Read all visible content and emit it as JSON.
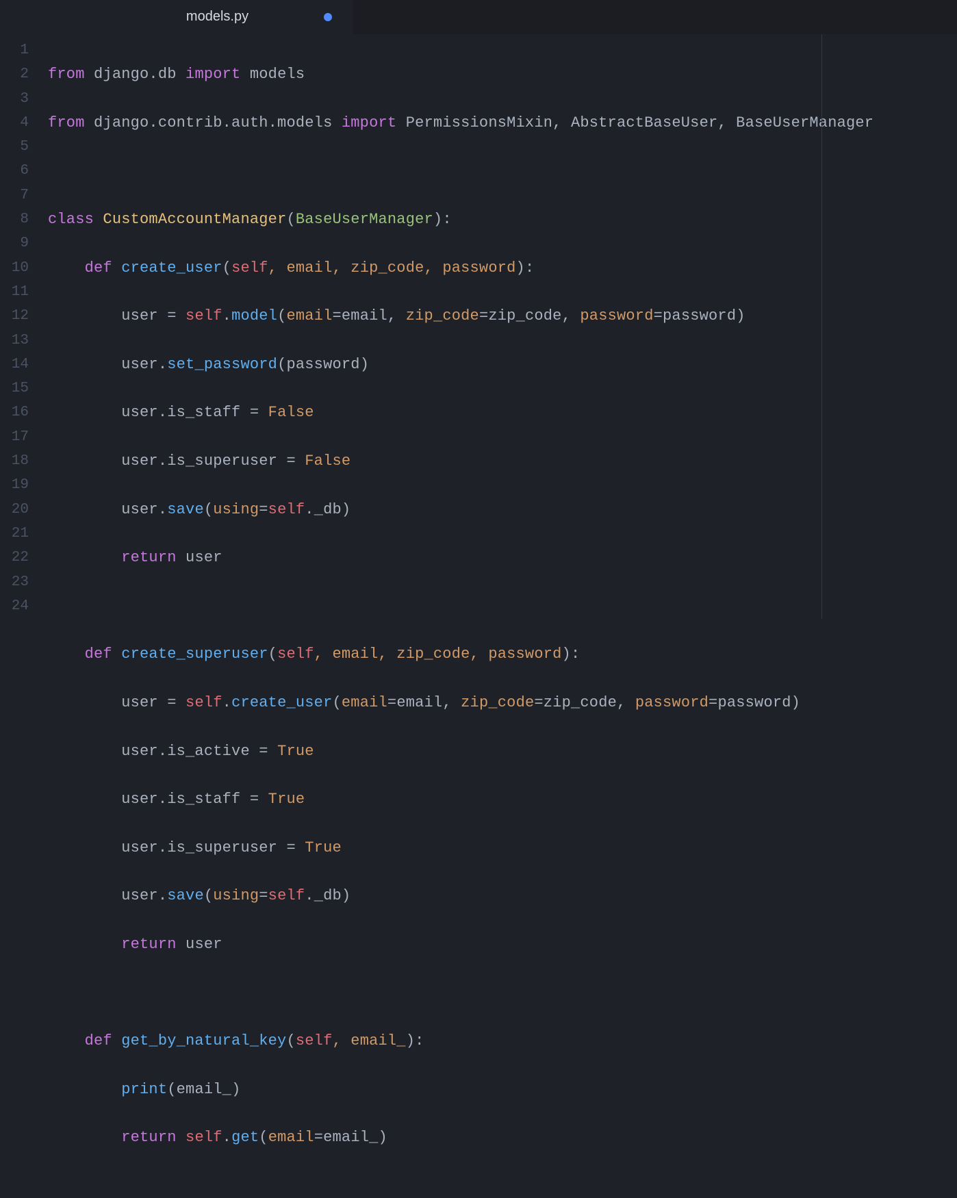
{
  "tab": {
    "label": "models.py",
    "dirty": true
  },
  "lines": [
    "1",
    "2",
    "3",
    "4",
    "5",
    "6",
    "7",
    "8",
    "9",
    "10",
    "11",
    "12",
    "13",
    "14",
    "15",
    "16",
    "17",
    "18",
    "19",
    "20",
    "21",
    "22",
    "23",
    "24"
  ],
  "code": {
    "l1": {
      "from": "from",
      "mod": " django.db ",
      "import": "import",
      "rest": " models"
    },
    "l2": {
      "from": "from",
      "mod": " django.contrib.auth.models ",
      "import": "import",
      "rest": " PermissionsMixin, AbstractBaseUser, BaseUserManager"
    },
    "l4": {
      "class": "class ",
      "name": "CustomAccountManager",
      "lp": "(",
      "base": "BaseUserManager",
      "rp": ")",
      "colon": ":"
    },
    "l5": {
      "indent": "    ",
      "def": "def ",
      "name": "create_user",
      "lp": "(",
      "self": "self",
      "args": ", email, zip_code, password",
      "rp": ")",
      "colon": ":"
    },
    "l6": {
      "indent": "        ",
      "v": "user ",
      "eq": "= ",
      "self": "self",
      "dot": ".",
      "fn": "model",
      "lp": "(",
      "k1": "email",
      "e1": "=",
      "v1": "email, ",
      "k2": "zip_code",
      "e2": "=",
      "v2": "zip_code, ",
      "k3": "password",
      "e3": "=",
      "v3": "password",
      "rp": ")"
    },
    "l7": {
      "indent": "        ",
      "pre": "user.",
      "fn": "set_password",
      "lp": "(",
      "arg": "password",
      "rp": ")"
    },
    "l8": {
      "indent": "        ",
      "pre": "user.is_staff ",
      "eq": "= ",
      "val": "False"
    },
    "l9": {
      "indent": "        ",
      "pre": "user.is_superuser ",
      "eq": "= ",
      "val": "False"
    },
    "l10": {
      "indent": "        ",
      "pre": "user.",
      "fn": "save",
      "lp": "(",
      "k": "using",
      "e": "=",
      "self": "self",
      "dot": ".",
      "attr": "_db",
      "rp": ")"
    },
    "l11": {
      "indent": "        ",
      "ret": "return",
      "rest": " user"
    },
    "l13": {
      "indent": "    ",
      "def": "def ",
      "name": "create_superuser",
      "lp": "(",
      "self": "self",
      "args": ", email, zip_code, password",
      "rp": ")",
      "colon": ":"
    },
    "l14": {
      "indent": "        ",
      "v": "user ",
      "eq": "= ",
      "self": "self",
      "dot": ".",
      "fn": "create_user",
      "lp": "(",
      "k1": "email",
      "e1": "=",
      "v1": "email, ",
      "k2": "zip_code",
      "e2": "=",
      "v2": "zip_code, ",
      "k3": "password",
      "e3": "=",
      "v3": "password",
      "rp": ")"
    },
    "l15": {
      "indent": "        ",
      "pre": "user.is_active ",
      "eq": "= ",
      "val": "True"
    },
    "l16": {
      "indent": "        ",
      "pre": "user.is_staff ",
      "eq": "= ",
      "val": "True"
    },
    "l17": {
      "indent": "        ",
      "pre": "user.is_superuser ",
      "eq": "= ",
      "val": "True"
    },
    "l18": {
      "indent": "        ",
      "pre": "user.",
      "fn": "save",
      "lp": "(",
      "k": "using",
      "e": "=",
      "self": "self",
      "dot": ".",
      "attr": "_db",
      "rp": ")"
    },
    "l19": {
      "indent": "        ",
      "ret": "return",
      "rest": " user"
    },
    "l21": {
      "indent": "    ",
      "def": "def ",
      "name": "get_by_natural_key",
      "lp": "(",
      "self": "self",
      "args": ", email_",
      "rp": ")",
      "colon": ":"
    },
    "l22": {
      "indent": "        ",
      "fn": "print",
      "lp": "(",
      "arg": "email_",
      "rp": ")"
    },
    "l23": {
      "indent": "        ",
      "ret": "return",
      "sp": " ",
      "self": "self",
      "dot": ".",
      "fn": "get",
      "lp": "(",
      "k": "email",
      "e": "=",
      "v": "email_",
      "rp": ")"
    }
  }
}
